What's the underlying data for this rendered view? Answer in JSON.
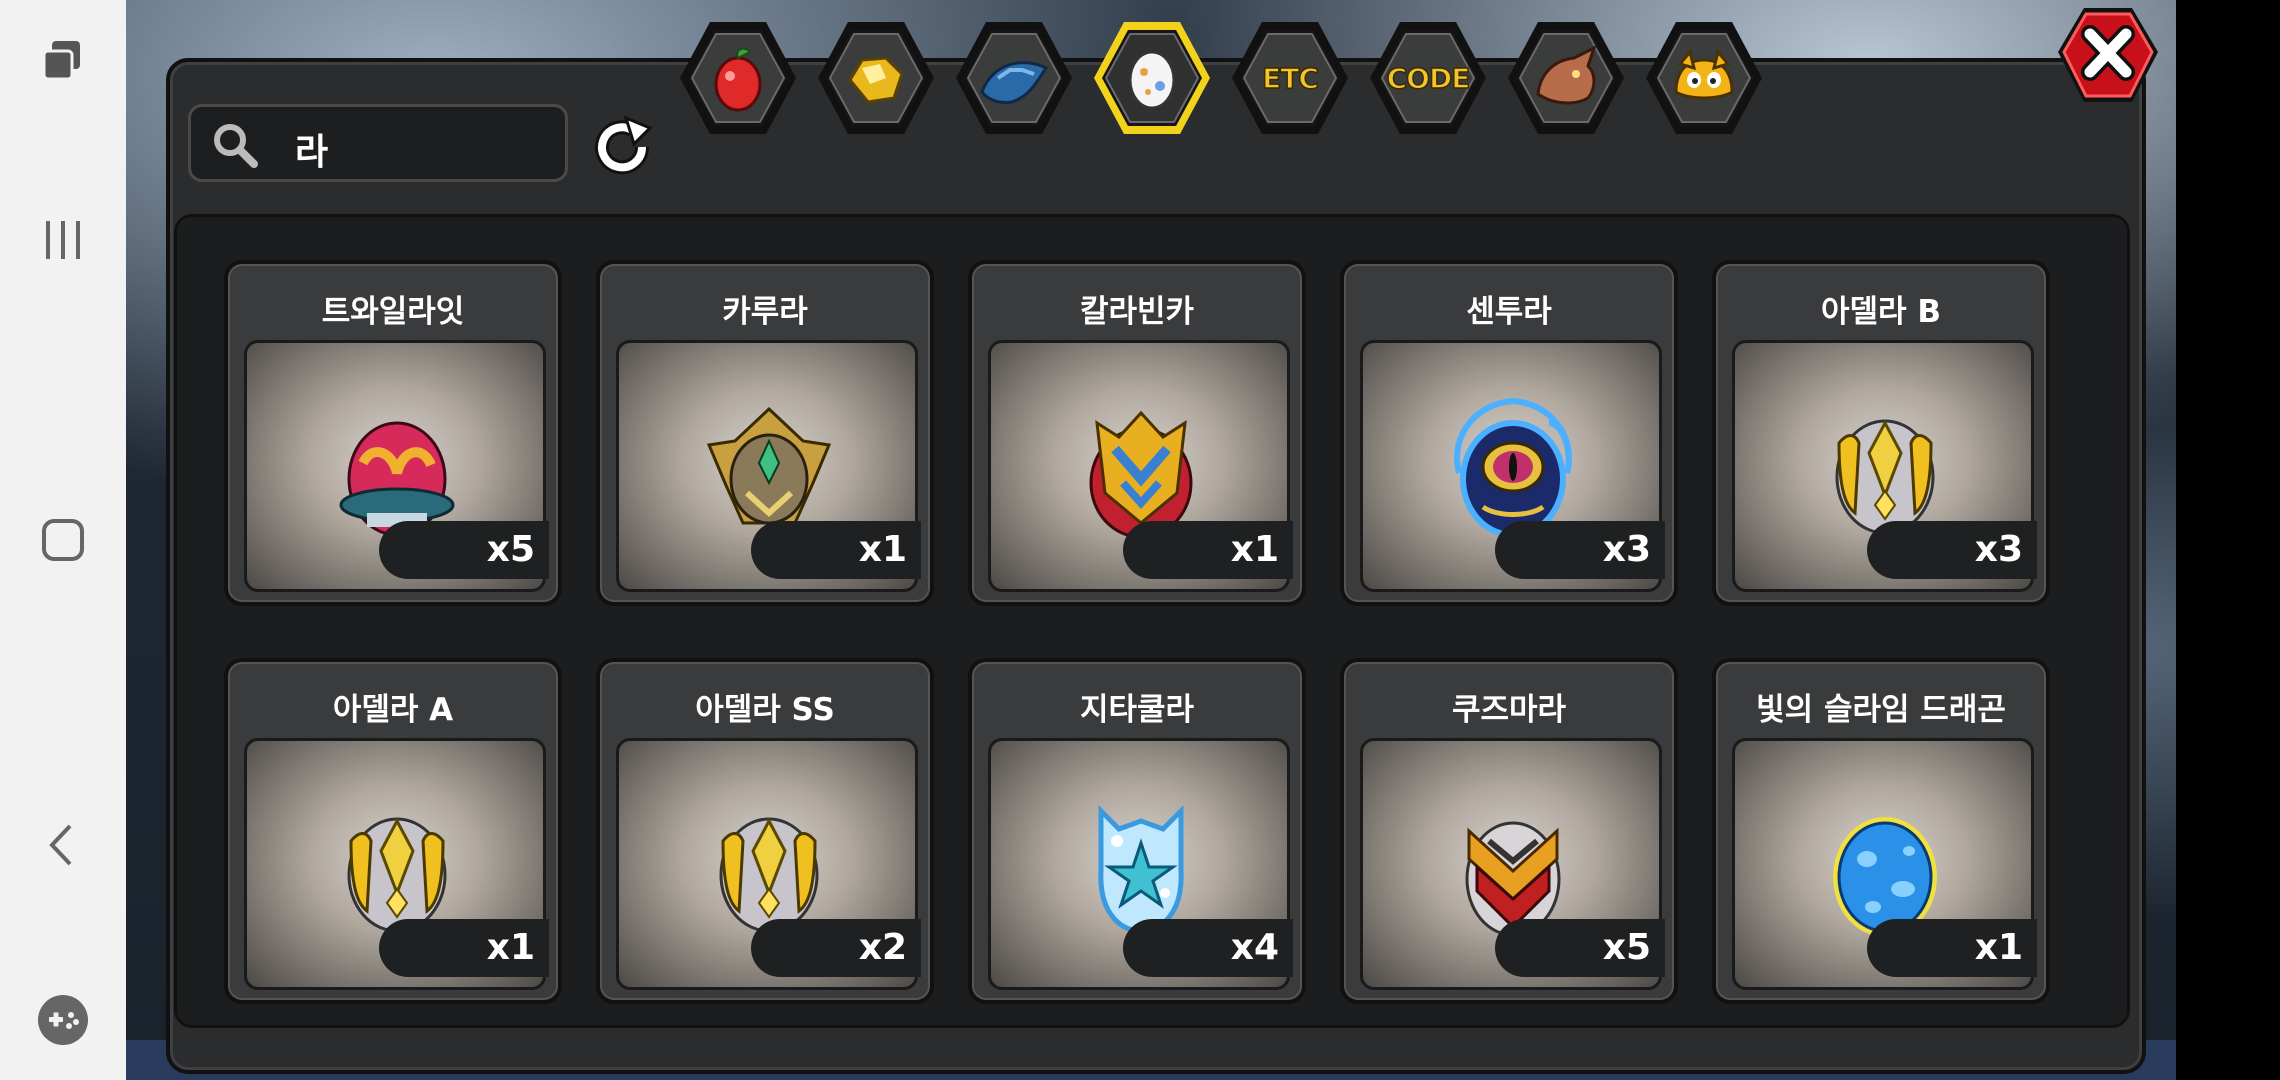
{
  "search": {
    "query": "라"
  },
  "tabs": [
    {
      "name": "fruit",
      "label": "",
      "icon": "fruit-icon"
    },
    {
      "name": "gold-ore",
      "label": "",
      "icon": "gold-ore-icon"
    },
    {
      "name": "dragon-scale",
      "label": "",
      "icon": "dragon-scale-icon"
    },
    {
      "name": "egg",
      "label": "",
      "icon": "egg-icon",
      "selected": true
    },
    {
      "name": "etc",
      "label": "ETC",
      "icon": ""
    },
    {
      "name": "code",
      "label": "CODE",
      "icon": ""
    },
    {
      "name": "dragon-head",
      "label": "",
      "icon": "dragon-head-icon"
    },
    {
      "name": "slime-face",
      "label": "",
      "icon": "slime-face-icon"
    }
  ],
  "items": [
    {
      "name": "트와일라잇",
      "qty": "x5",
      "egg": "twilight"
    },
    {
      "name": "카루라",
      "qty": "x1",
      "egg": "karura"
    },
    {
      "name": "칼라빈카",
      "qty": "x1",
      "egg": "kalavinka"
    },
    {
      "name": "센투라",
      "qty": "x3",
      "egg": "centura"
    },
    {
      "name": "아델라 B",
      "qty": "x3",
      "egg": "adela"
    },
    {
      "name": "아델라 A",
      "qty": "x1",
      "egg": "adela"
    },
    {
      "name": "아델라 SS",
      "qty": "x2",
      "egg": "adela"
    },
    {
      "name": "지타쿨라",
      "qty": "x4",
      "egg": "zitakula"
    },
    {
      "name": "쿠즈마라",
      "qty": "x5",
      "egg": "kuzmara"
    },
    {
      "name": "빛의 슬라임 드래곤",
      "qty": "x1",
      "egg": "light-slime"
    }
  ],
  "colors": {
    "accent_yellow": "#f3d21c",
    "close_red": "#c8101a",
    "panel": "#2b2c2e"
  }
}
